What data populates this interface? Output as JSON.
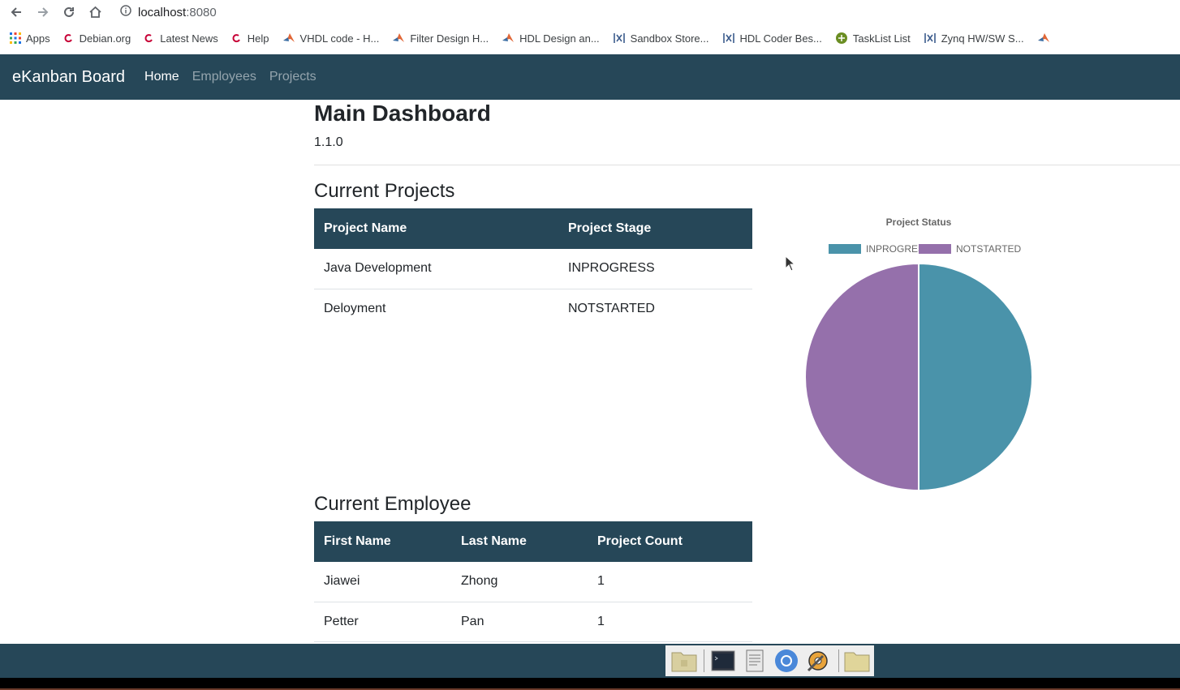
{
  "browser": {
    "url_host": "localhost",
    "url_port": ":8080",
    "icons": {
      "back": "arrow-left-icon",
      "forward": "arrow-right-icon",
      "reload": "reload-icon",
      "home": "home-icon",
      "site_info": "info-icon"
    },
    "bookmarks": [
      {
        "label": "Apps",
        "icon": "apps-grid-icon"
      },
      {
        "label": "Debian.org",
        "icon": "debian-swirl-icon"
      },
      {
        "label": "Latest News",
        "icon": "debian-swirl-icon"
      },
      {
        "label": "Help",
        "icon": "debian-swirl-icon"
      },
      {
        "label": "VHDL code - H...",
        "icon": "matlab-icon"
      },
      {
        "label": "Filter Design H...",
        "icon": "matlab-icon"
      },
      {
        "label": "HDL Design an...",
        "icon": "matlab-icon"
      },
      {
        "label": "Sandbox Store...",
        "icon": "xilinx-icon"
      },
      {
        "label": "HDL Coder Bes...",
        "icon": "xilinx-icon"
      },
      {
        "label": "TaskList List",
        "icon": "green-circle-icon"
      },
      {
        "label": "Zynq HW/SW S...",
        "icon": "xilinx-icon"
      }
    ]
  },
  "navbar": {
    "brand": "eKanban Board",
    "links": [
      {
        "label": "Home",
        "active": true
      },
      {
        "label": "Employees",
        "active": false
      },
      {
        "label": "Projects",
        "active": false
      }
    ]
  },
  "main": {
    "title": "Main Dashboard",
    "version": "1.1.0",
    "projects_section": {
      "title": "Current Projects",
      "headers": [
        "Project Name",
        "Project Stage"
      ],
      "rows": [
        [
          "Java Development",
          "INPROGRESS"
        ],
        [
          "Deloyment",
          "NOTSTARTED"
        ]
      ]
    },
    "employees_section": {
      "title": "Current Employee",
      "headers": [
        "First Name",
        "Last Name",
        "Project Count"
      ],
      "rows": [
        [
          "Jiawei",
          "Zhong",
          "1"
        ],
        [
          "Petter",
          "Pan",
          "1"
        ]
      ]
    }
  },
  "chart_data": {
    "type": "pie",
    "title": "Project Status",
    "categories": [
      "INPROGRESS",
      "NOTSTARTED"
    ],
    "values": [
      1,
      1
    ],
    "colors": [
      "#4a93aa",
      "#9570ab"
    ],
    "legend": "top"
  },
  "taskbar": {
    "items": [
      "file-manager-icon",
      "terminal-icon",
      "text-editor-icon",
      "chromium-icon",
      "settings-tool-icon",
      "folder-icon"
    ]
  }
}
